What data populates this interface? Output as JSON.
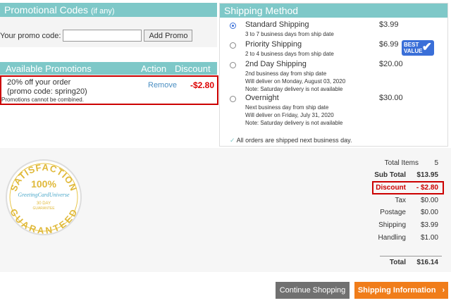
{
  "promo_codes": {
    "title": "Promotional Codes",
    "title_suffix": "(if any)",
    "input_label": "Your promo code:",
    "input_value": "",
    "add_button": "Add Promo"
  },
  "available_promotions": {
    "headers": [
      "Available Promotions",
      "Action",
      "Discount"
    ],
    "item": {
      "line1": "20% off your order",
      "line2": "(promo code: spring20)",
      "action": "Remove",
      "discount": "-$2.80"
    },
    "note": "Promotions cannot be combined."
  },
  "shipping": {
    "title": "Shipping Method",
    "options": [
      {
        "name": "Standard Shipping",
        "desc": [
          "3 to 7 business days from ship date"
        ],
        "price": "$3.99",
        "selected": true
      },
      {
        "name": "Priority Shipping",
        "desc": [
          "2 to 4 business days from ship date"
        ],
        "price": "$6.99",
        "selected": false
      },
      {
        "name": "2nd Day Shipping",
        "desc": [
          "2nd business day from ship date",
          "Will deliver on Monday, August 03, 2020",
          "Note: Saturday delivery is not available"
        ],
        "price": "$20.00",
        "selected": false
      },
      {
        "name": "Overnight",
        "desc": [
          "Next business day from ship date",
          "Will deliver on Friday, July 31, 2020",
          "Note: Saturday delivery is not available"
        ],
        "price": "$30.00",
        "selected": false
      }
    ],
    "best_value_line1": "BEST",
    "best_value_line2": "VALUE",
    "note": "All orders are shipped next business day."
  },
  "seal": {
    "top": "SATISFACTION",
    "percent": "100%",
    "brand": "GreetingCardUniverse",
    "days": "30 DAY",
    "guarantee": "GUARANTEE",
    "bottom": "GUARANTEED"
  },
  "summary": {
    "total_items_label": "Total Items",
    "total_items": "5",
    "subtotal_label": "Sub Total",
    "subtotal": "$13.95",
    "discount_label": "Discount",
    "discount": "- $2.80",
    "tax_label": "Tax",
    "tax": "$0.00",
    "postage_label": "Postage",
    "postage": "$0.00",
    "shipping_label": "Shipping",
    "shipping": "$3.99",
    "handling_label": "Handling",
    "handling": "$1.00",
    "total_label": "Total",
    "total": "$16.14"
  },
  "buttons": {
    "continue": "Continue Shopping",
    "shipping_info": "Shipping Information",
    "shipping_info_arrow": "›"
  },
  "colors": {
    "accent": "#7ec8c8",
    "highlight": "#cc0000",
    "orange": "#f07d1a",
    "best_value": "#3a6fd8"
  }
}
